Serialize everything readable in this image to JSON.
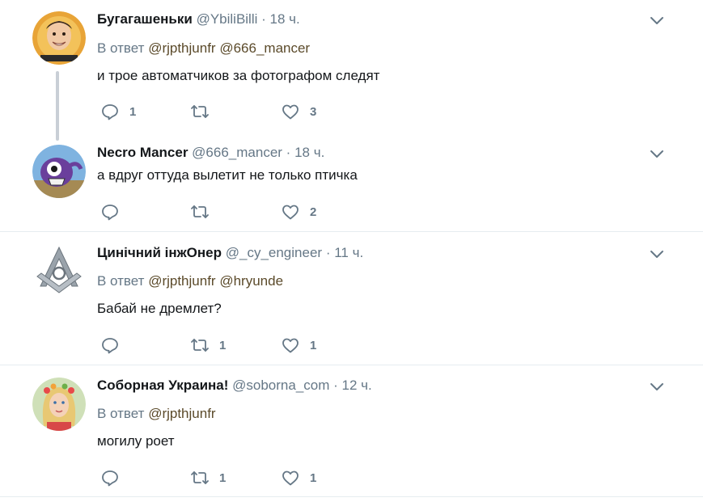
{
  "tweets": [
    {
      "name": "Бугагашеньки",
      "handle": "@YbiliBilli",
      "dot": "·",
      "time": "18 ч.",
      "reply_prefix": "В ответ",
      "mentions": [
        "@rjpthjunfr",
        "@666_mancer"
      ],
      "text": "и трое автоматчиков за фотографом следят",
      "reply_count": "1",
      "retweet_count": "",
      "like_count": "3",
      "avatar_label": "БУГАГАШЕНЬКИ"
    },
    {
      "name": "Necro Mancer",
      "handle": "@666_mancer",
      "dot": "·",
      "time": "18 ч.",
      "text": "а вдруг оттуда вылетит не только птичка",
      "reply_count": "",
      "retweet_count": "",
      "like_count": "2"
    },
    {
      "name": "Цинічний інжОнер",
      "handle": "@_cy_engineer",
      "dot": "·",
      "time": "11 ч.",
      "reply_prefix": "В ответ",
      "mentions": [
        "@rjpthjunfr",
        "@hryunde"
      ],
      "text": "Бабай не дремлет?",
      "reply_count": "",
      "retweet_count": "1",
      "like_count": "1"
    },
    {
      "name": "Соборная Украина!",
      "handle": "@soborna_com",
      "dot": "·",
      "time": "12 ч.",
      "reply_prefix": "В ответ",
      "mentions": [
        "@rjpthjunfr"
      ],
      "text": "могилу роет",
      "reply_count": "",
      "retweet_count": "1",
      "like_count": "1"
    }
  ],
  "colors": {
    "text": "#14171a",
    "muted": "#657786",
    "mention": "#5b4a2a",
    "divider": "#e6ecf0",
    "icon": "#657786"
  },
  "icons": [
    "reply-icon",
    "retweet-icon",
    "like-icon",
    "chevron-down-icon"
  ]
}
